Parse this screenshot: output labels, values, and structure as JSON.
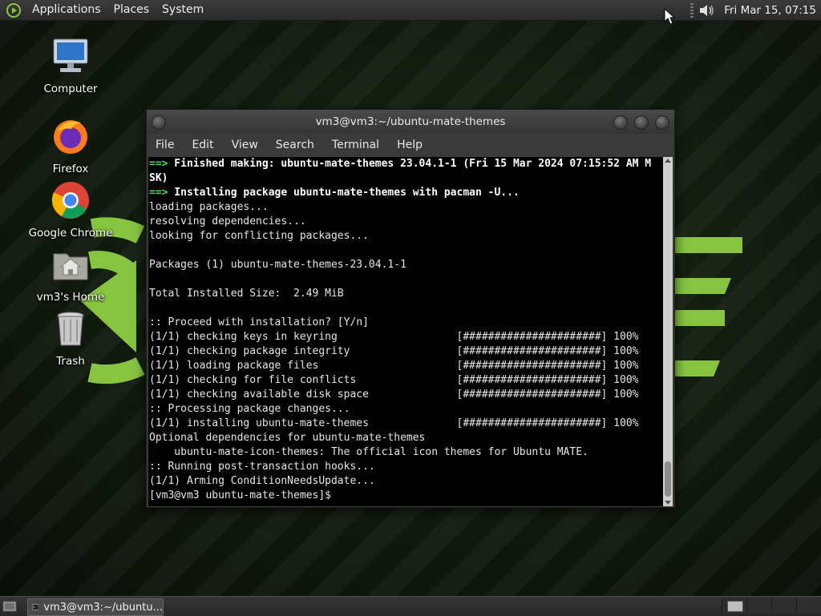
{
  "top_panel": {
    "menus": [
      "Applications",
      "Places",
      "System"
    ],
    "clock": "Fri Mar 15, 07:15",
    "volume_icon": "speaker-icon"
  },
  "desktop": {
    "icons": [
      {
        "label": "Computer",
        "icon": "computer-icon"
      },
      {
        "label": "Firefox",
        "icon": "firefox-icon"
      },
      {
        "label": "Google Chrome",
        "icon": "chrome-icon"
      },
      {
        "label": "vm3's Home",
        "icon": "home-folder-icon"
      },
      {
        "label": "Trash",
        "icon": "trash-icon"
      }
    ]
  },
  "window": {
    "title": "vm3@vm3:~/ubuntu-mate-themes",
    "menus": [
      "File",
      "Edit",
      "View",
      "Search",
      "Terminal",
      "Help"
    ]
  },
  "terminal": {
    "lines": [
      "==> Finished making: ubuntu-mate-themes 23.04.1-1 (Fri 15 Mar 2024 07:15:52 AM M",
      "SK)",
      "==> Installing package ubuntu-mate-themes with pacman -U...",
      "loading packages...",
      "resolving dependencies...",
      "looking for conflicting packages...",
      "",
      "Packages (1) ubuntu-mate-themes-23.04.1-1",
      "",
      "Total Installed Size:  2.49 MiB",
      "",
      ":: Proceed with installation? [Y/n]",
      "(1/1) checking keys in keyring                   [######################] 100%",
      "(1/1) checking package integrity                 [######################] 100%",
      "(1/1) loading package files                      [######################] 100%",
      "(1/1) checking for file conflicts                [######################] 100%",
      "(1/1) checking available disk space              [######################] 100%",
      ":: Processing package changes...",
      "(1/1) installing ubuntu-mate-themes              [######################] 100%",
      "Optional dependencies for ubuntu-mate-themes",
      "    ubuntu-mate-icon-themes: The official icon themes for Ubuntu MATE.",
      ":: Running post-transaction hooks...",
      "(1/1) Arming ConditionNeedsUpdate...",
      "[vm3@vm3 ubuntu-mate-themes]$"
    ]
  },
  "bottom_panel": {
    "task_label": "vm3@vm3:~/ubuntu..."
  },
  "colors": {
    "accent_green": "#87c540",
    "prompt_arrow": "#5dd35d"
  }
}
